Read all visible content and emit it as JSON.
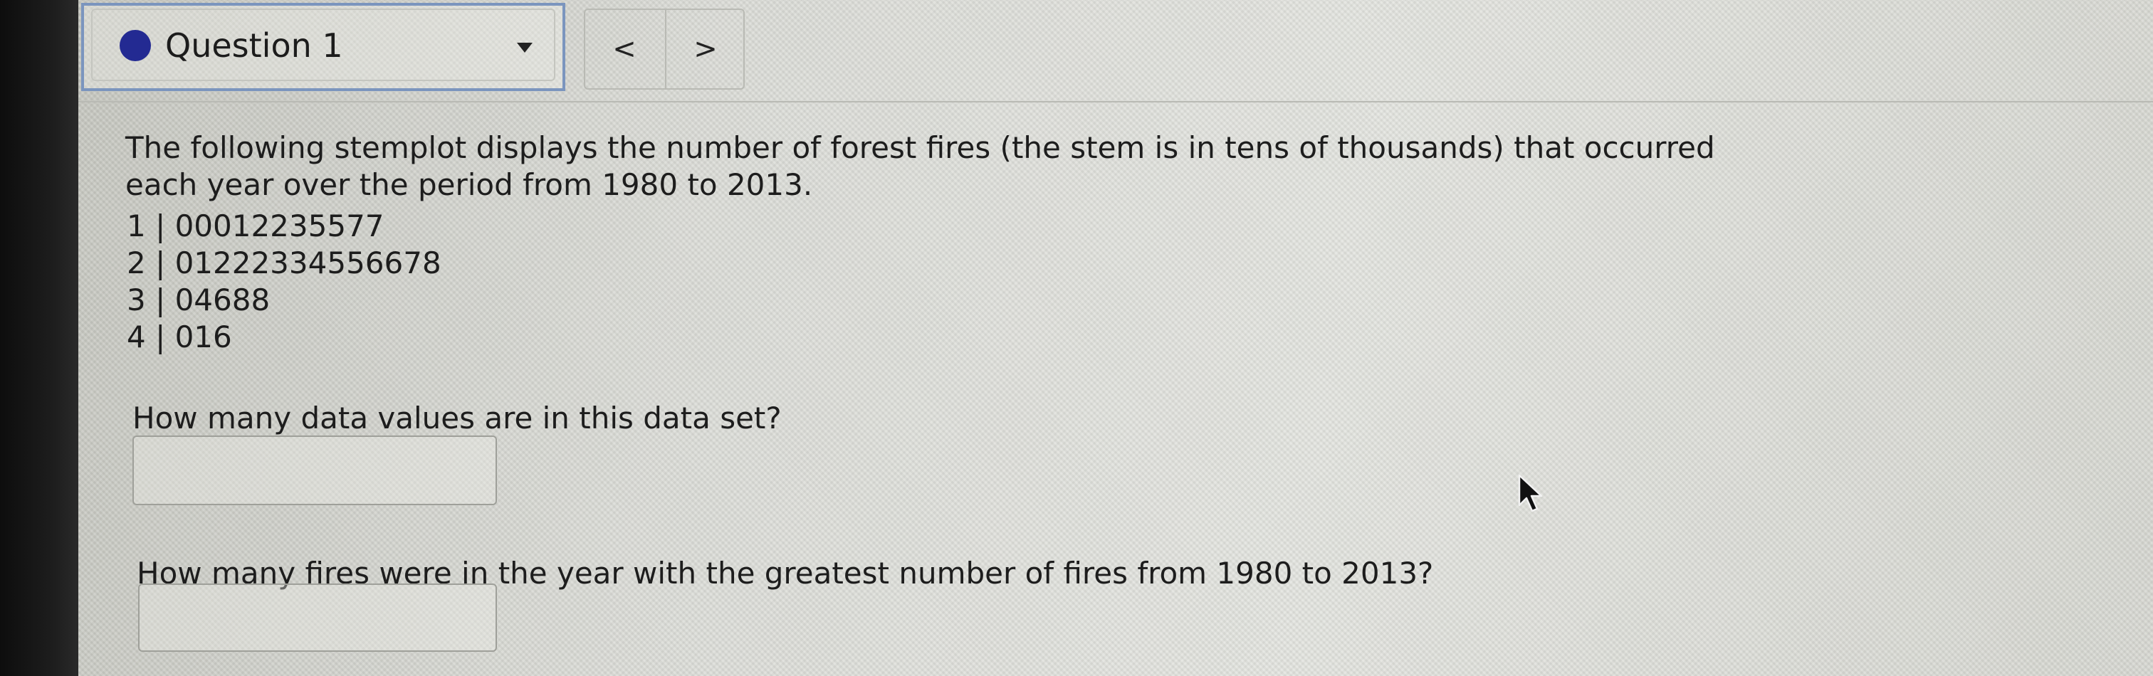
{
  "question_nav": {
    "selected_label": "Question 1",
    "prev_label": "<",
    "next_label": ">"
  },
  "problem": {
    "prompt": "The following stemplot displays the number of forest fires (the stem is in tens of thousands) that occurred each year over the period from 1980 to 2013.",
    "stemplot": [
      "1 | 00012235577",
      "2 | 01222334556678",
      "3 | 04688",
      "4 | 016"
    ]
  },
  "questions": [
    {
      "text": "How many data values are in this data set?",
      "answer_value": ""
    },
    {
      "text": "How many fires were in the year with the greatest number of fires from 1980 to 2013?",
      "answer_value": ""
    }
  ],
  "icons": {
    "status": "filled-circle-icon",
    "dropdown": "caret-down-icon",
    "cursor": "mouse-pointer-icon"
  },
  "colors": {
    "status_dot": "#232a92",
    "select_border": "#7b95be"
  }
}
